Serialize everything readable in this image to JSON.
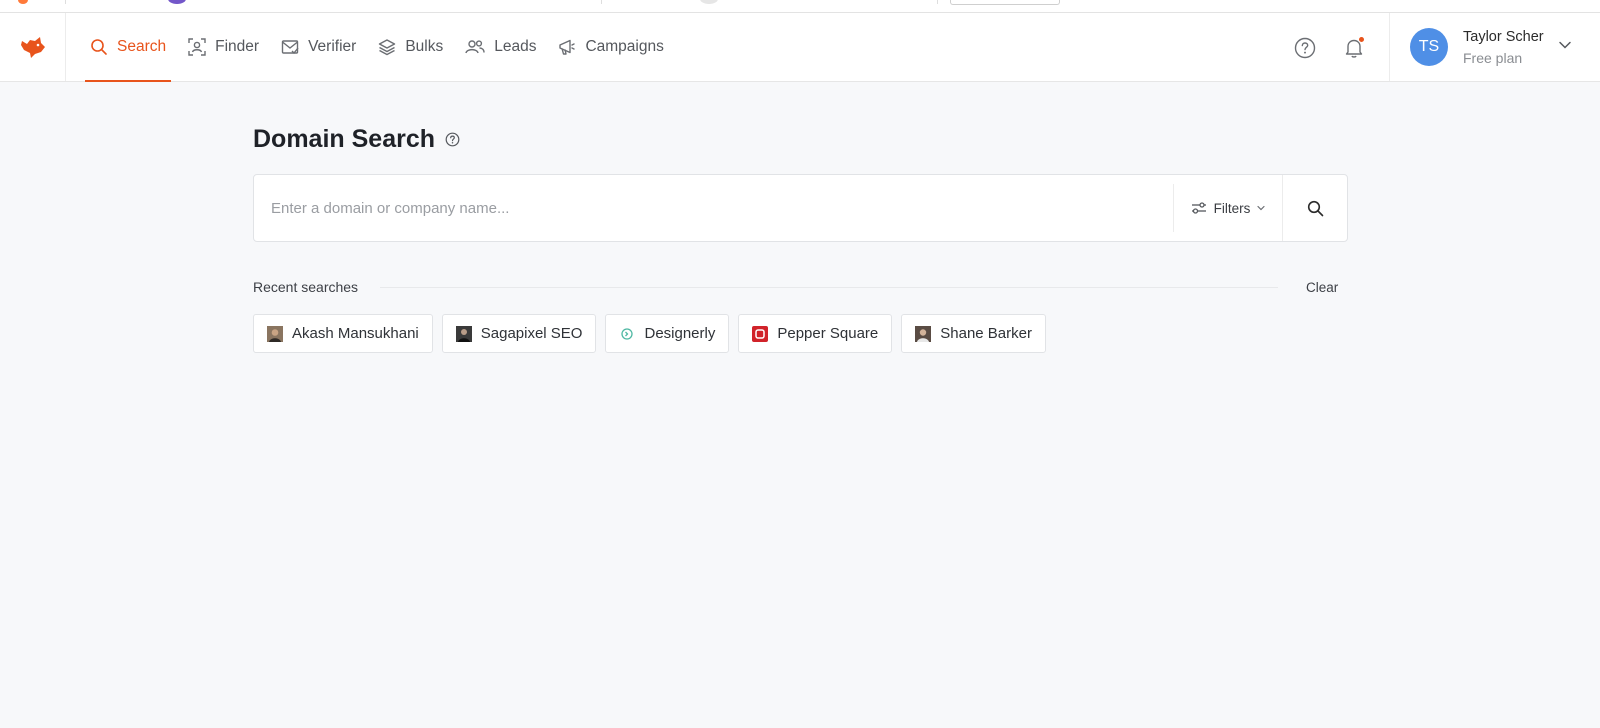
{
  "nav": {
    "items": [
      {
        "label": "Search",
        "icon": "search-icon",
        "active": true
      },
      {
        "label": "Finder",
        "icon": "finder-icon",
        "active": false
      },
      {
        "label": "Verifier",
        "icon": "verifier-icon",
        "active": false
      },
      {
        "label": "Bulks",
        "icon": "layers-icon",
        "active": false
      },
      {
        "label": "Leads",
        "icon": "users-icon",
        "active": false
      },
      {
        "label": "Campaigns",
        "icon": "megaphone-icon",
        "active": false
      }
    ],
    "accent_color": "#e8541c"
  },
  "user": {
    "initials": "TS",
    "name": "Taylor Scher",
    "plan": "Free plan",
    "avatar_color": "#4f8fe6"
  },
  "page": {
    "title": "Domain Search"
  },
  "search": {
    "placeholder": "Enter a domain or company name...",
    "value": "",
    "filters_label": "Filters"
  },
  "recent": {
    "label": "Recent searches",
    "clear_label": "Clear",
    "items": [
      {
        "label": "Akash Mansukhani",
        "thumb": "person-photo"
      },
      {
        "label": "Sagapixel SEO",
        "thumb": "person-photo"
      },
      {
        "label": "Designerly",
        "thumb": "designerly-logo"
      },
      {
        "label": "Pepper Square",
        "thumb": "pepper-square-logo"
      },
      {
        "label": "Shane Barker",
        "thumb": "person-photo"
      }
    ]
  }
}
